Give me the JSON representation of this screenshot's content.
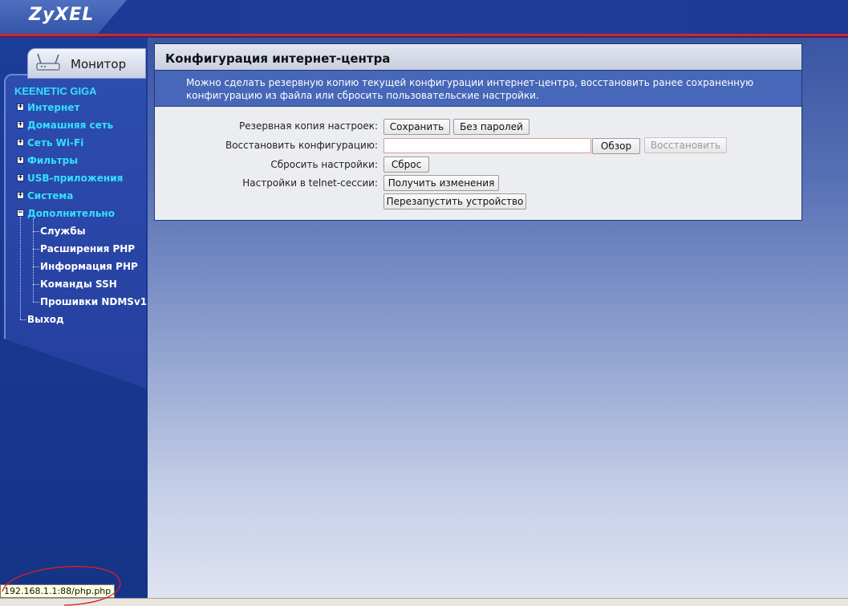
{
  "header": {
    "logo": "ZyXEL",
    "accent_color": "#c8283a"
  },
  "sidebar": {
    "monitor_tab": {
      "label": "Монитор",
      "icon": "router-icon"
    },
    "device_name": "KEENETIC GIGA",
    "items": [
      {
        "label": "Интернет",
        "expander": "+"
      },
      {
        "label": "Домашняя сеть",
        "expander": "+"
      },
      {
        "label": "Сеть Wi-Fi",
        "expander": "+"
      },
      {
        "label": "Фильтры",
        "expander": "+"
      },
      {
        "label": "USB-приложения",
        "expander": "+"
      },
      {
        "label": "Система",
        "expander": "+"
      },
      {
        "label": "Дополнительно",
        "expander": "−"
      }
    ],
    "subitems": [
      {
        "label": "Службы"
      },
      {
        "label": "Расширения PHP"
      },
      {
        "label": "Информация PHP"
      },
      {
        "label": "Команды SSH"
      },
      {
        "label": "Прошивки NDMSv1"
      }
    ],
    "exit": "Выход"
  },
  "panel": {
    "title": "Конфигурация интернет-центра",
    "description": "Можно сделать резервную копию текущей конфигурации интернет-центра, восстановить ранее сохраненную конфигурацию из файла или сбросить пользовательские настройки.",
    "rows": {
      "backup_label": "Резервная копия настроек:",
      "save_button": "Сохранить",
      "no_passwords_button": "Без паролей",
      "restore_label": "Восстановить конфигурацию:",
      "file_value": "",
      "browse_button": "Обзор",
      "restore_button": "Восстановить",
      "reset_label": "Сбросить настройки:",
      "reset_button": "Сброс",
      "telnet_label": "Настройки в telnet-сессии:",
      "get_changes_button": "Получить изменения",
      "restart_button": "Перезапустить устройство"
    }
  },
  "status": {
    "url_tooltip": "192.168.1.1:88/php.php"
  }
}
